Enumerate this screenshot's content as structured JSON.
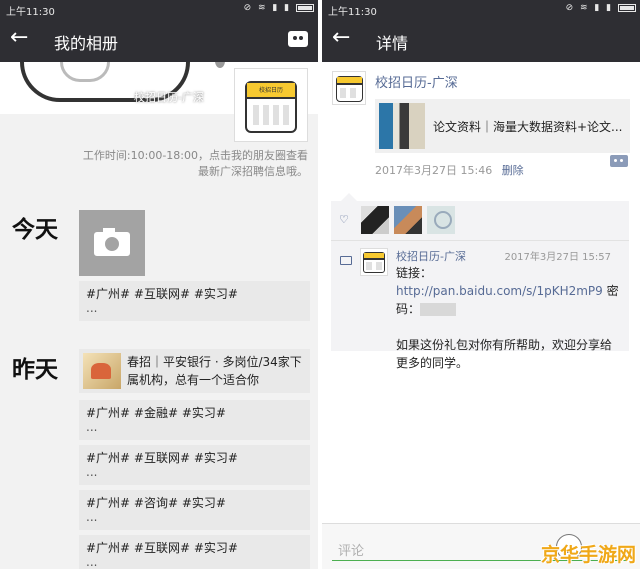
{
  "status_bar": {
    "time": "上午11:30"
  },
  "left": {
    "back": "←",
    "title": "我的相册",
    "cover_name": "校招日历-广深",
    "calendar_label": "校招日历",
    "info_line1": "工作时间:10:00-18:00，点击我的朋友圈查看",
    "info_line2": "最新广深招聘信息哦。",
    "today": "今天",
    "yesterday": "昨天",
    "posts": [
      {
        "text": "#广州# #互联网# #实习#",
        "more": "..."
      },
      {
        "text": "春招｜平安银行 · 多岗位/34家下属机构，总有一个适合你"
      },
      {
        "text": "#广州# #金融# #实习#",
        "more": "..."
      },
      {
        "text": "#广州# #互联网# #实习#",
        "more": "..."
      },
      {
        "text": "#广州# #咨询# #实习#",
        "more": "..."
      },
      {
        "text": "#广州# #互联网# #实习#",
        "more": "..."
      }
    ]
  },
  "right": {
    "back": "←",
    "title": "详情",
    "poster_name": "校招日历-广深",
    "link_title": "论文资料｜海量大数据资料+论文...",
    "timestamp": "2017年3月27日 15:46",
    "delete": "删除",
    "comment": {
      "name": "校招日历-广深",
      "time": "2017年3月27日 15:57",
      "link_prefix": "链接：",
      "link_url": "http://pan.baidu.com/s/1pKH2mP9",
      "pw_label": " 密码：",
      "message": "如果这份礼包对你有所帮助，欢迎分享给更多的同学。"
    },
    "input_placeholder": "评论"
  },
  "watermark": "京华手游网"
}
